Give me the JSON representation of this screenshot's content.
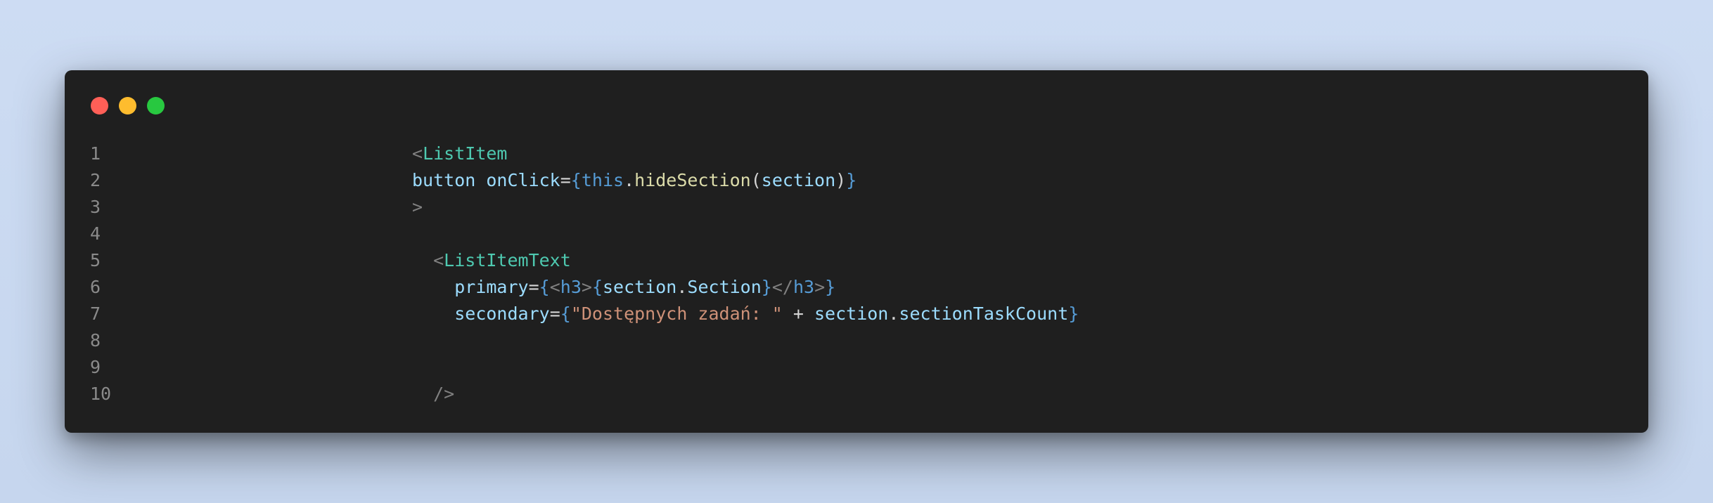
{
  "window": {
    "controls": {
      "close_color": "#ff5f57",
      "minimize_color": "#febc2e",
      "maximize_color": "#28c840"
    }
  },
  "code": {
    "lines": [
      {
        "number": "1",
        "indent": "",
        "tokens": [
          {
            "t": "<",
            "c": "tag-bracket"
          },
          {
            "t": "ListItem",
            "c": "tag-name"
          }
        ]
      },
      {
        "number": "2",
        "indent": "",
        "tokens": [
          {
            "t": "button",
            "c": "attr"
          },
          {
            "t": " ",
            "c": "punct"
          },
          {
            "t": "onClick",
            "c": "attr"
          },
          {
            "t": "=",
            "c": "punct"
          },
          {
            "t": "{",
            "c": "brace"
          },
          {
            "t": "this",
            "c": "kw"
          },
          {
            "t": ".",
            "c": "punct"
          },
          {
            "t": "hideSection",
            "c": "fn"
          },
          {
            "t": "(",
            "c": "punct"
          },
          {
            "t": "section",
            "c": "var"
          },
          {
            "t": ")",
            "c": "punct"
          },
          {
            "t": "}",
            "c": "brace"
          }
        ]
      },
      {
        "number": "3",
        "indent": "",
        "tokens": [
          {
            "t": ">",
            "c": "tag-bracket"
          }
        ]
      },
      {
        "number": "4",
        "indent": "",
        "tokens": []
      },
      {
        "number": "5",
        "indent": "  ",
        "tokens": [
          {
            "t": "<",
            "c": "tag-bracket"
          },
          {
            "t": "ListItemText",
            "c": "tag-name"
          }
        ]
      },
      {
        "number": "6",
        "indent": "    ",
        "tokens": [
          {
            "t": "primary",
            "c": "attr"
          },
          {
            "t": "=",
            "c": "punct"
          },
          {
            "t": "{",
            "c": "brace"
          },
          {
            "t": "<",
            "c": "tag-bracket"
          },
          {
            "t": "h3",
            "c": "html-tag"
          },
          {
            "t": ">",
            "c": "tag-bracket"
          },
          {
            "t": "{",
            "c": "brace"
          },
          {
            "t": "section",
            "c": "var"
          },
          {
            "t": ".",
            "c": "punct"
          },
          {
            "t": "Section",
            "c": "var"
          },
          {
            "t": "}",
            "c": "brace"
          },
          {
            "t": "</",
            "c": "tag-bracket"
          },
          {
            "t": "h3",
            "c": "html-tag"
          },
          {
            "t": ">",
            "c": "tag-bracket"
          },
          {
            "t": "}",
            "c": "brace"
          }
        ]
      },
      {
        "number": "7",
        "indent": "    ",
        "tokens": [
          {
            "t": "secondary",
            "c": "attr"
          },
          {
            "t": "=",
            "c": "punct"
          },
          {
            "t": "{",
            "c": "brace"
          },
          {
            "t": "\"Dostępnych zadań: \"",
            "c": "str"
          },
          {
            "t": " + ",
            "c": "punct"
          },
          {
            "t": "section",
            "c": "var"
          },
          {
            "t": ".",
            "c": "punct"
          },
          {
            "t": "sectionTaskCount",
            "c": "var"
          },
          {
            "t": "}",
            "c": "brace"
          }
        ]
      },
      {
        "number": "8",
        "indent": "",
        "tokens": []
      },
      {
        "number": "9",
        "indent": "",
        "tokens": []
      },
      {
        "number": "10",
        "indent": "  ",
        "tokens": [
          {
            "t": "/>",
            "c": "tag-bracket"
          }
        ]
      }
    ]
  }
}
